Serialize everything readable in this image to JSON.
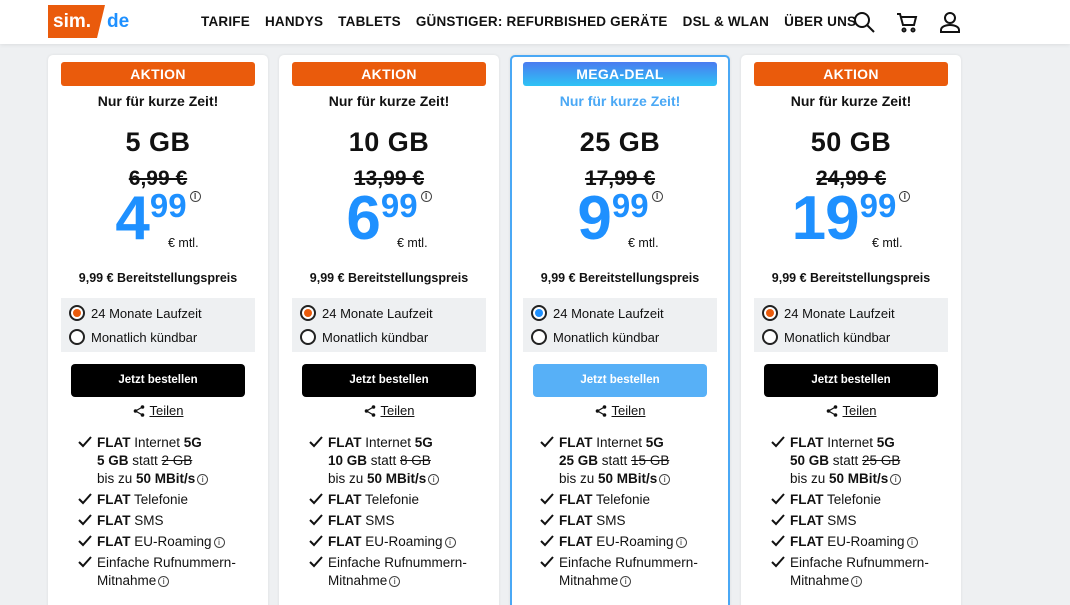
{
  "brand": {
    "logo_main": "sim.",
    "logo_suffix": "de"
  },
  "nav": [
    "TARIFE",
    "HANDYS",
    "TABLETS",
    "GÜNSTIGER: REFURBISHED GERÄTE",
    "DSL & WLAN",
    "ÜBER UNS"
  ],
  "header_icons": [
    "search-icon",
    "cart-icon",
    "user-icon"
  ],
  "colors": {
    "brand_orange": "#ea5b0c",
    "price_blue": "#1e90ff",
    "highlight_blue": "#4aa8f5"
  },
  "common": {
    "unit": "€ mtl.",
    "setup": "9,99 € Bereitstellungspreis",
    "option1": "24 Monate Laufzeit",
    "option2": "Monatlich kündbar",
    "order": "Jetzt bestellen",
    "share": "Teilen",
    "info": "i",
    "f_flat": "FLAT",
    "f_internet": " Internet ",
    "f_5g": "5G",
    "f_statt": " statt ",
    "f_bis": "bis zu ",
    "f_speed": "50 MBit/s",
    "f_tel": " Telefonie",
    "f_sms": " SMS",
    "f_roam": " EU-Roaming",
    "f_port1": "Einfache Rufnummern-",
    "f_port2": "Mitnahme"
  },
  "cards": [
    {
      "badge": "AKTION",
      "subtitle": "Nur für kurze Zeit!",
      "volume": "5 GB",
      "old_price": "6,99 €",
      "price_main": "4",
      "price_dec": "99",
      "new_gb": "5 GB",
      "old_gb": "2 GB",
      "selected_option": "24 Monate Laufzeit"
    },
    {
      "badge": "AKTION",
      "subtitle": "Nur für kurze Zeit!",
      "volume": "10 GB",
      "old_price": "13,99 €",
      "price_main": "6",
      "price_dec": "99",
      "new_gb": "10 GB",
      "old_gb": "8 GB",
      "selected_option": "24 Monate Laufzeit"
    },
    {
      "badge": "MEGA-DEAL",
      "subtitle": "Nur für kurze Zeit!",
      "volume": "25 GB",
      "old_price": "17,99 €",
      "price_main": "9",
      "price_dec": "99",
      "new_gb": "25 GB",
      "old_gb": "15 GB",
      "selected_option": "24 Monate Laufzeit"
    },
    {
      "badge": "AKTION",
      "subtitle": "Nur für kurze Zeit!",
      "volume": "50 GB",
      "old_price": "24,99 €",
      "price_main": "19",
      "price_dec": "99",
      "new_gb": "50 GB",
      "old_gb": "25 GB",
      "selected_option": "24 Monate Laufzeit"
    }
  ]
}
